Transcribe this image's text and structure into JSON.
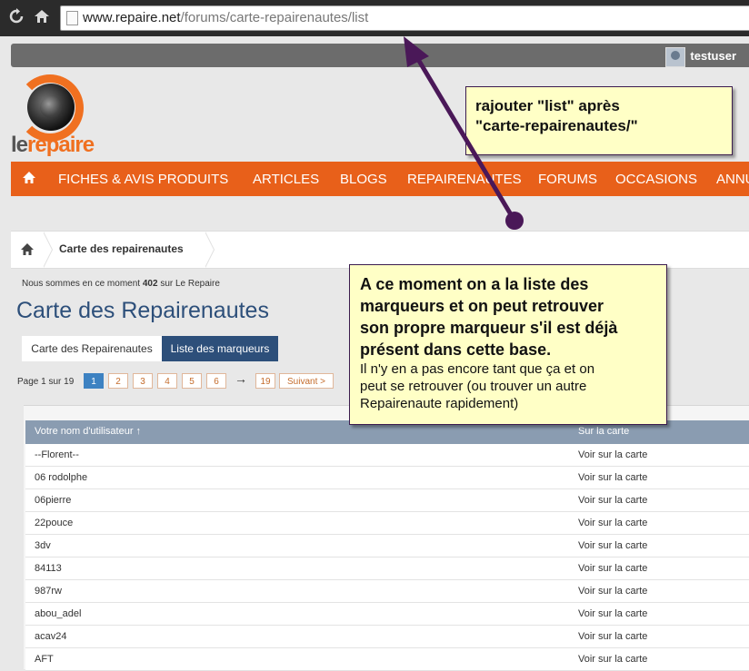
{
  "browser": {
    "url_domain": "www.repaire.net",
    "url_path": "/forums/carte-repairenautes/list",
    "back_icon": "refresh-icon",
    "home_icon": "home-icon"
  },
  "user": {
    "name": "testuser"
  },
  "logo": {
    "le": "le",
    "repaire": "repaire"
  },
  "nav": {
    "items": [
      "FICHES & AVIS PRODUITS",
      "ARTICLES",
      "BLOGS",
      "REPAIRENAUTES",
      "FORUMS",
      "OCCASIONS",
      "ANNU"
    ]
  },
  "breadcrumb": {
    "current": "Carte des repairenautes"
  },
  "online": {
    "prefix": "Nous sommes en ce moment",
    "count": "402",
    "suffix": "sur Le Repaire"
  },
  "page_title": "Carte des Repairenautes",
  "tabs": [
    "Carte des Repairenautes",
    "Liste des marqueurs"
  ],
  "pagination": {
    "label": "Page 1 sur 19",
    "pages": [
      "1",
      "2",
      "3",
      "4",
      "5",
      "6"
    ],
    "arrow": "→",
    "last": "19",
    "next": "Suivant >"
  },
  "table": {
    "headers": [
      "Votre nom d'utilisateur ↑",
      "Sur la carte"
    ],
    "rows": [
      {
        "name": "--Florent--",
        "link": "Voir sur la carte"
      },
      {
        "name": "06 rodolphe",
        "link": "Voir sur la carte"
      },
      {
        "name": "06pierre",
        "link": "Voir sur la carte"
      },
      {
        "name": "22pouce",
        "link": "Voir sur la carte"
      },
      {
        "name": "3dv",
        "link": "Voir sur la carte"
      },
      {
        "name": "84113",
        "link": "Voir sur la carte"
      },
      {
        "name": "987rw",
        "link": "Voir sur la carte"
      },
      {
        "name": "abou_adel",
        "link": "Voir sur la carte"
      },
      {
        "name": "acav24",
        "link": "Voir sur la carte"
      },
      {
        "name": "AFT",
        "link": "Voir sur la carte"
      }
    ]
  },
  "annotations": {
    "note1": [
      "rajouter \"list\" après",
      "\"carte-repairenautes/\""
    ],
    "note2_big": [
      "A ce moment on a la liste des",
      "marqueurs et on peut retrouver",
      "son propre marqueur s'il est déjà",
      "présent dans cette base."
    ],
    "note2_small": [
      "Il n'y en a pas encore tant que ça et on",
      "peut se retrouver (ou trouver un autre",
      "Repairenaute rapidement)"
    ]
  },
  "colors": {
    "accent": "#e8601a",
    "title": "#2d4f7a",
    "annotation_bg": "#ffffc6",
    "arrow": "#4a1858"
  }
}
